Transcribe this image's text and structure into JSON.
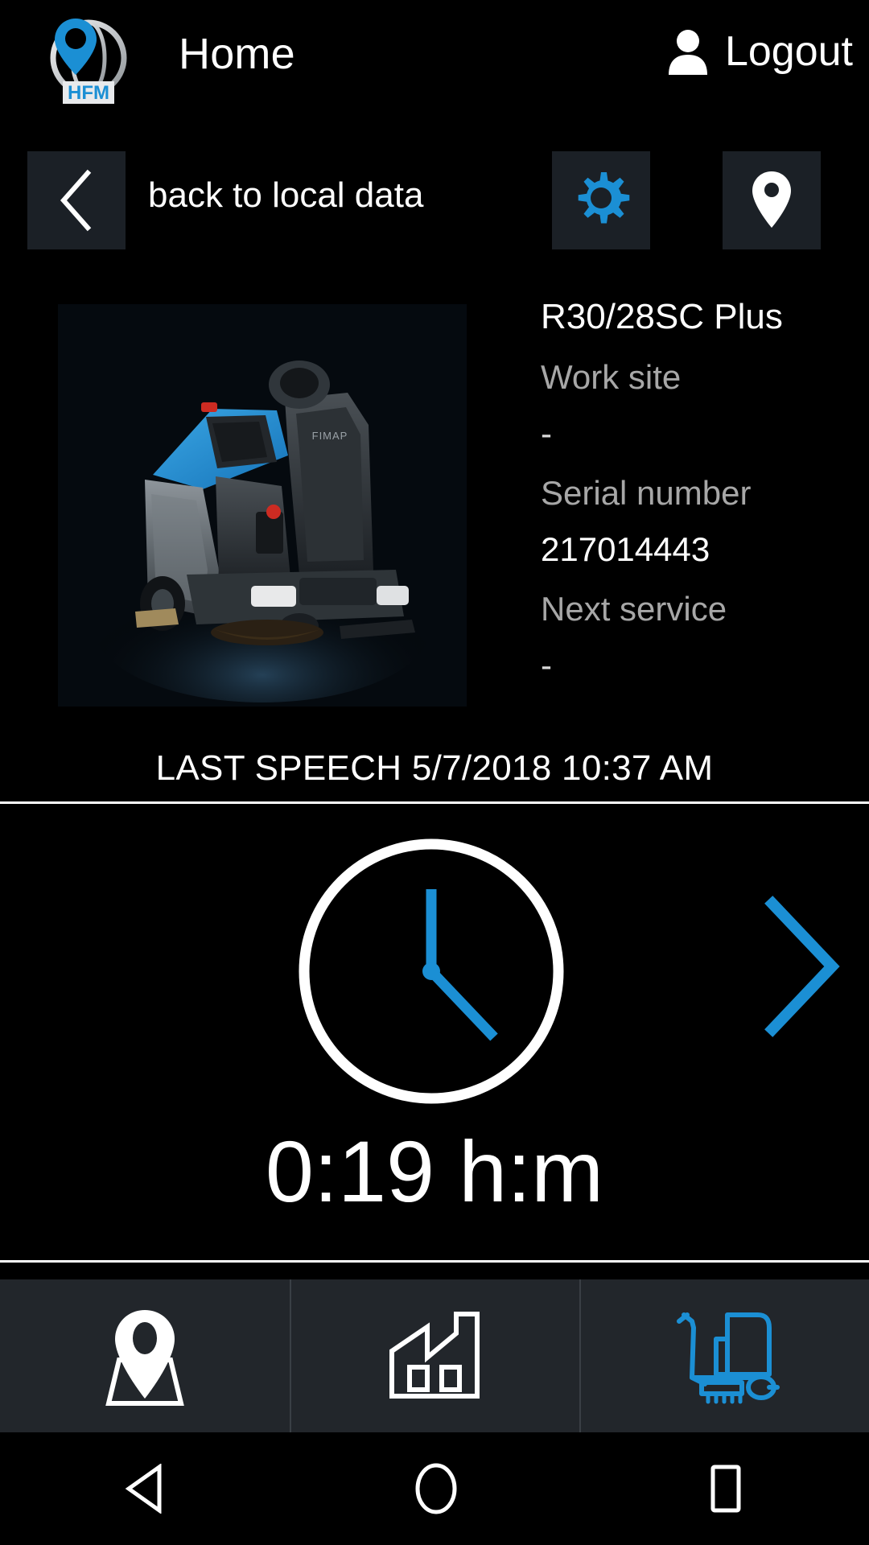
{
  "header": {
    "logo_text": "HFM",
    "logo_icon": "globe-location-pin-logo",
    "title": "Home",
    "logout_label": "Logout",
    "logout_icon": "person-icon"
  },
  "subbar": {
    "back_icon": "chevron-left-icon",
    "back_label": "back to local data",
    "settings_icon": "gear-icon",
    "location_icon": "map-pin-icon"
  },
  "machine": {
    "photo_alt": "ride-on-floor-scrubber-photo",
    "brand_on_machine": "FIMAP",
    "model": "R30/28SC Plus",
    "worksite_label": "Work site",
    "worksite_value": "-",
    "serial_label": "Serial number",
    "serial_value": "217014443",
    "next_service_label": "Next service",
    "next_service_value": "-"
  },
  "status": {
    "last_speech": "LAST SPEECH 5/7/2018 10:37 AM"
  },
  "metric": {
    "icon": "clock-icon",
    "value": "0:19 h:m",
    "next_icon": "chevron-right-icon",
    "clock_hour_angle_deg": 130,
    "clock_minute_angle_deg": 0
  },
  "tabs": [
    {
      "name": "map",
      "icon": "map-pin-location-icon",
      "active": false
    },
    {
      "name": "site",
      "icon": "factory-icon",
      "active": false
    },
    {
      "name": "machine",
      "icon": "floor-scrubber-icon",
      "active": true
    }
  ],
  "navbar": {
    "back_icon": "android-back-triangle-icon",
    "home_icon": "android-home-circle-icon",
    "recents_icon": "android-recents-square-icon"
  },
  "colors": {
    "accent_blue": "#1b8fd4",
    "background": "#000000",
    "panel": "#1b2026",
    "tabbar": "#22262b",
    "label_gray": "#a7a7a7",
    "divider": "#ffffff"
  }
}
